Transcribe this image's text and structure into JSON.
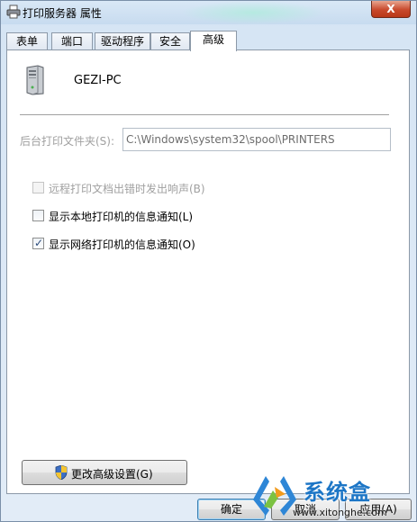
{
  "window": {
    "title": "打印服务器 属性",
    "close_label": "X"
  },
  "tabs": [
    {
      "label": "表单"
    },
    {
      "label": "端口"
    },
    {
      "label": "驱动程序"
    },
    {
      "label": "安全"
    },
    {
      "label": "高级",
      "active": true
    }
  ],
  "advanced": {
    "computer_name": "GEZI-PC",
    "spool_folder_label": "后台打印文件夹(S):",
    "spool_folder_value": "C:\\Windows\\system32\\spool\\PRINTERS",
    "options": [
      {
        "label": "远程打印文档出错时发出响声(B)",
        "checked": false,
        "disabled": true
      },
      {
        "label": "显示本地打印机的信息通知(L)",
        "checked": false,
        "disabled": false
      },
      {
        "label": "显示网络打印机的信息通知(O)",
        "checked": true,
        "disabled": false
      }
    ],
    "change_settings_button": "更改高级设置(G)"
  },
  "footer": {
    "ok_label": "确定",
    "cancel_label": "取消",
    "apply_label": "应用(A)"
  },
  "watermark": {
    "brand": "系统盒",
    "url": "www.xitonghe.com"
  },
  "colors": {
    "accent": "#1d76c6",
    "close_button": "#c8492c",
    "disabled_text": "#a0a0a0"
  }
}
